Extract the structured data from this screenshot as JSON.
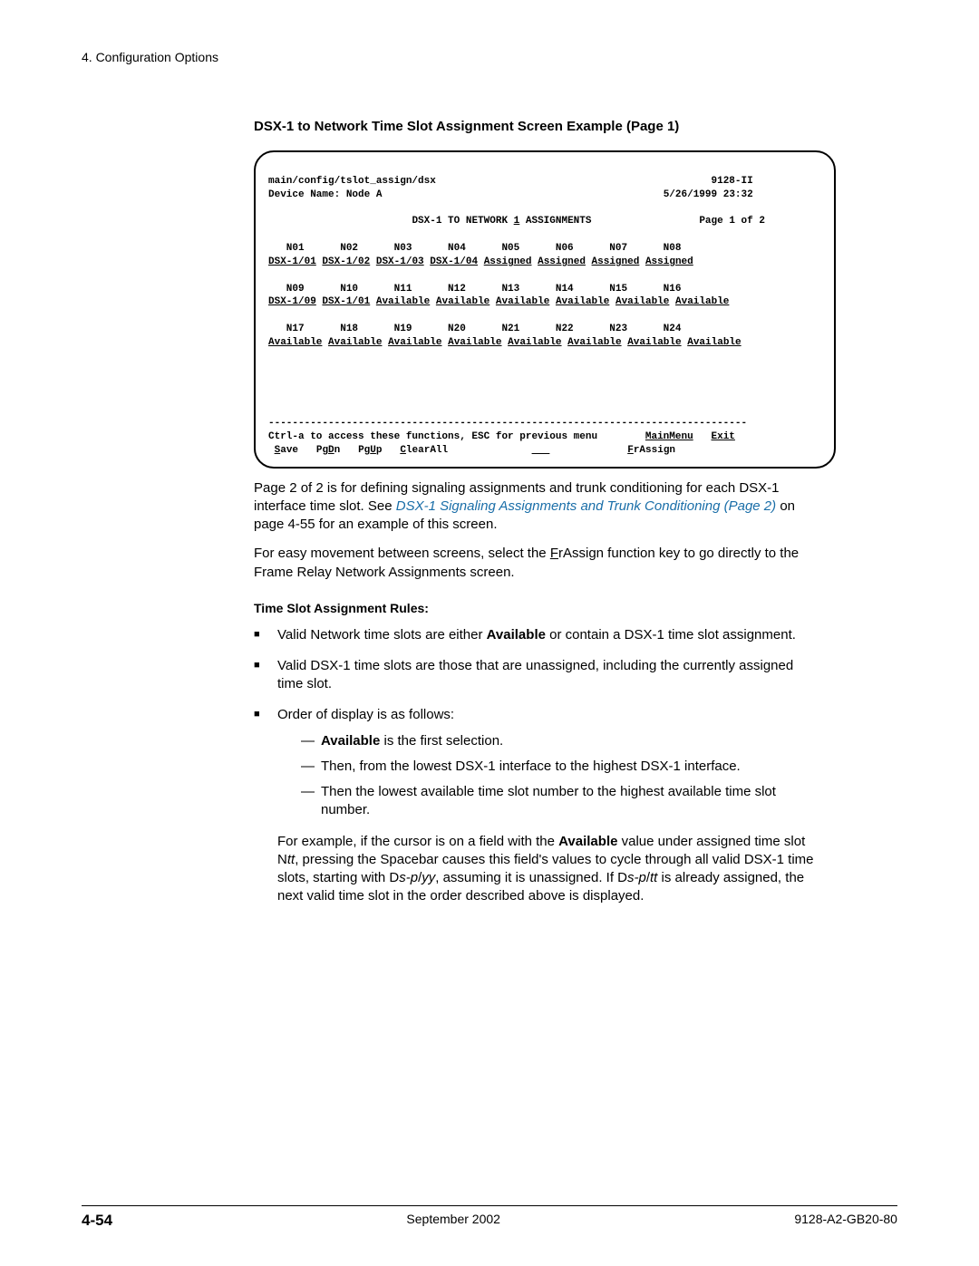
{
  "header": {
    "chapter": "4. Configuration Options"
  },
  "section_title": "DSX-1 to Network Time Slot Assignment Screen Example (Page 1)",
  "terminal": {
    "path": "main/config/tslot_assign/dsx",
    "model": "9128-II",
    "device_name_label": "Device Name:",
    "device_name_value": "Node A",
    "datetime": "5/26/1999 23:32",
    "screen_title_pre": "DSX-1 TO NETWORK ",
    "screen_title_underlined": "1",
    "screen_title_post": " ASSIGNMENTS",
    "page_indicator": "Page 1 of 2",
    "row1_header": "   N01      N02      N03      N04      N05      N06      N07      N08",
    "row1_vals": [
      "DSX-1/01",
      "DSX-1/02",
      "DSX-1/03",
      "DSX-1/04",
      "Assigned",
      "Assigned",
      "Assigned",
      "Assigned"
    ],
    "row2_header": "   N09      N10      N11      N12      N13      N14      N15      N16",
    "row2_vals": [
      "DSX-1/09",
      "DSX-1/01",
      "Available",
      "Available",
      "Available",
      "Available",
      "Available",
      "Available"
    ],
    "row3_header": "   N17      N18      N19      N20      N21      N22      N23      N24",
    "row3_vals": [
      "Available",
      "Available",
      "Available",
      "Available",
      "Available",
      "Available",
      "Available",
      "Available"
    ],
    "help_line": "Ctrl-a to access these functions, ESC for previous menu",
    "fn_mainmenu": "MainMenu",
    "fn_exit": "Exit",
    "fn_save_u": "S",
    "fn_save": "ave",
    "fn_pgdn": "Pg",
    "fn_pgdn_u": "D",
    "fn_pgdn2": "n",
    "fn_pgup": "Pg",
    "fn_pgup_u": "U",
    "fn_pgup2": "p",
    "fn_clearall_u": "C",
    "fn_clearall": "learAll",
    "fn_frassign_u": "F",
    "fn_frassign": "rAssign"
  },
  "body": {
    "p1a": "Page 2 of 2 is for defining signaling assignments and trunk conditioning for each DSX-1 interface time slot. See ",
    "p1_link": "DSX-1 Signaling Assignments and Trunk Conditioning (Page 2)",
    "p1b": " on page 4-55 for an example of this screen.",
    "p2a": "For easy movement between screens, select the ",
    "p2_u": "F",
    "p2b": "rAssign function key to go directly to the Frame Relay Network Assignments screen.",
    "rules_heading": "Time Slot Assignment Rules:",
    "rule1a": "Valid Network time slots are either ",
    "rule1_bold": "Available",
    "rule1b": " or contain a DSX-1 time slot assignment.",
    "rule2": "Valid DSX-1 time slots are those that are unassigned, including the currently assigned time slot.",
    "rule3": "Order of display is as follows:",
    "rule3_sub1_bold": "Available",
    "rule3_sub1": " is the first selection.",
    "rule3_sub2": "Then, from the lowest DSX-1 interface to the highest DSX-1 interface.",
    "rule3_sub3": "Then the lowest available time slot number to the highest available time slot number.",
    "example_a": "For example, if the cursor is on a field with the ",
    "example_bold1": "Available",
    "example_b": " value under assigned time slot N",
    "example_it1": "tt",
    "example_c": ", pressing the Spacebar causes this field's values to cycle through all valid DSX-1 time slots, starting with D",
    "example_it2": "s-p",
    "example_d": "/",
    "example_it3": "yy",
    "example_e": ", assuming it is unassigned. If D",
    "example_it4": "s-p",
    "example_f": "/",
    "example_it5": "tt",
    "example_g": " is already assigned, the next valid time slot in the order described above is displayed."
  },
  "footer": {
    "page_num": "4-54",
    "date": "September 2002",
    "doc_id": "9128-A2-GB20-80"
  }
}
